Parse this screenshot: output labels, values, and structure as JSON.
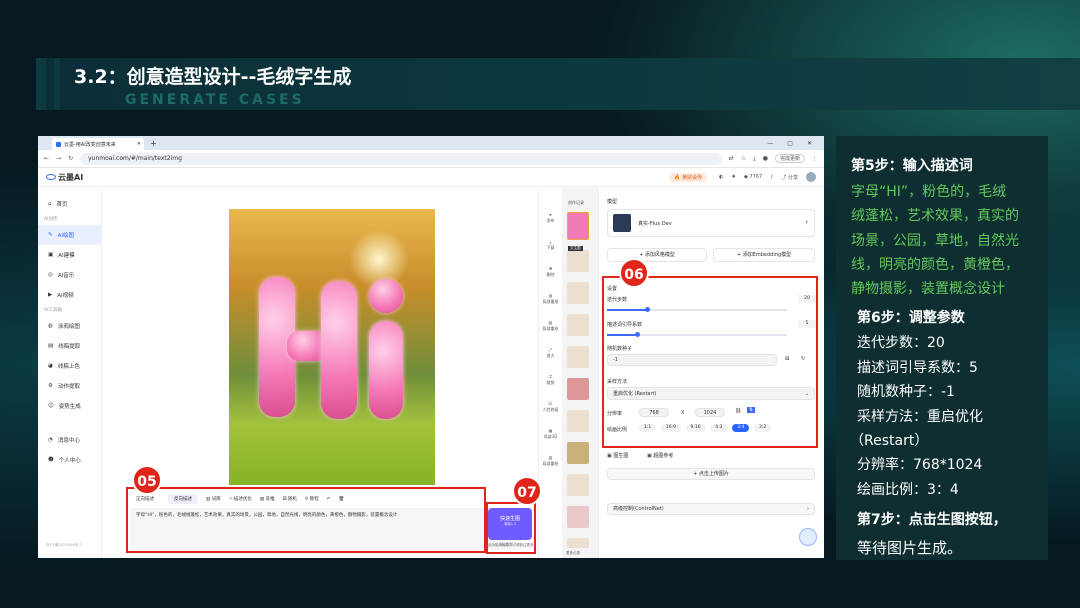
{
  "slide": {
    "title": "3.2：创意造型设计--毛绒字生成",
    "subtitle": "GENERATE CASES"
  },
  "browser": {
    "tab_title": "云墨-用AI改变创意未来",
    "url": "yunmoai.com/#/main/text2img",
    "update_btn": "完成更新"
  },
  "app": {
    "logo": "云墨AI",
    "vip": "黄财会传",
    "header_points": "7767",
    "share": "分享",
    "sidebar": {
      "items": [
        {
          "label": "首页"
        },
        {
          "group": "AI创作"
        },
        {
          "label": "AI绘图",
          "active": true
        },
        {
          "label": "AI建模"
        },
        {
          "label": "AI音乐"
        },
        {
          "label": "AI视频"
        },
        {
          "group": "AI工具箱"
        },
        {
          "label": "涂鸦绘图"
        },
        {
          "label": "线稿提取"
        },
        {
          "label": "线稿上色"
        },
        {
          "label": "动作提取"
        },
        {
          "label": "姿势生成"
        },
        {
          "label": "消息中心"
        },
        {
          "label": "个人中心"
        }
      ],
      "footer": "浙ICP备2023XXX号-2"
    },
    "tools": [
      "发布",
      "下载",
      "删除",
      "局部重绘",
      "局部重绘",
      "放大",
      "裁剪",
      "人脸修复",
      "局部3D",
      "局部重绘"
    ],
    "history": {
      "title": "创作记录",
      "more": "更多记录",
      "badge": "文生图"
    },
    "prompt": {
      "tabs": [
        "正向描述",
        "反向描述"
      ],
      "toolbar": [
        "词库",
        "描述优化",
        "反推",
        "随机",
        "教程"
      ],
      "text": "字母“HI”，粉色的，毛绒绒蓬松，艺术效果，真实的场景，公园，草地，自然光线，明亮的颜色，黄橙色，静物摄影，装置概念设计",
      "count": "61/2000"
    },
    "generate": {
      "label": "快速生图",
      "sub": "消耗1.5",
      "note": "此功能消耗算力，请前往更多"
    },
    "settings": {
      "model_label": "模型",
      "model_name": "真实-Flux Dev",
      "add_style": "添加风格模型",
      "add_embed": "添加Embedding模型",
      "section": "设置",
      "steps_label": "迭代步数",
      "steps": "20",
      "guidance_label": "描述词引导系数",
      "guidance": "5",
      "seed_label": "随机数种子",
      "seed": "-1",
      "sampler_label": "采样方法",
      "sampler": "重启优化 (Restart)",
      "res_label": "分辨率",
      "width": "768",
      "x": "X",
      "height": "1024",
      "ratio_label": "绘画比例",
      "ratios": [
        "1:1",
        "16:9",
        "9:16",
        "4:3",
        "3:4",
        "3:2"
      ],
      "ratio_selected": "3:4",
      "img_label": "图生图",
      "img_ref": "超图参考",
      "upload": "点击上传图片",
      "controlnet": "高级控制(ControlNet)"
    }
  },
  "annotations": {
    "c05": "05",
    "c06": "06",
    "c07": "07"
  },
  "panel": {
    "step5": "第5步：输入描述词",
    "step5_lines": [
      "字母“HI”，粉色的，毛绒",
      "绒蓬松，艺术效果，真实的",
      "场景，公园，草地，自然光",
      "线，明亮的颜色，黄橙色，",
      "静物摄影，装置概念设计"
    ],
    "step6": "第6步：调整参数",
    "step6_lines": [
      "迭代步数：20",
      "描述词引导系数：5",
      "随机数种子：-1",
      "采样方法：重启优化",
      "（Restart）",
      "分辨率：768*1024",
      "绘画比例：3：4"
    ],
    "step7_lines": [
      "第7步：点击生图按钮，",
      "等待图片生成。"
    ]
  },
  "colors": {
    "accent": "#2a63ff",
    "annotation_red": "#e0261b",
    "panel_green": "#63c85a"
  }
}
